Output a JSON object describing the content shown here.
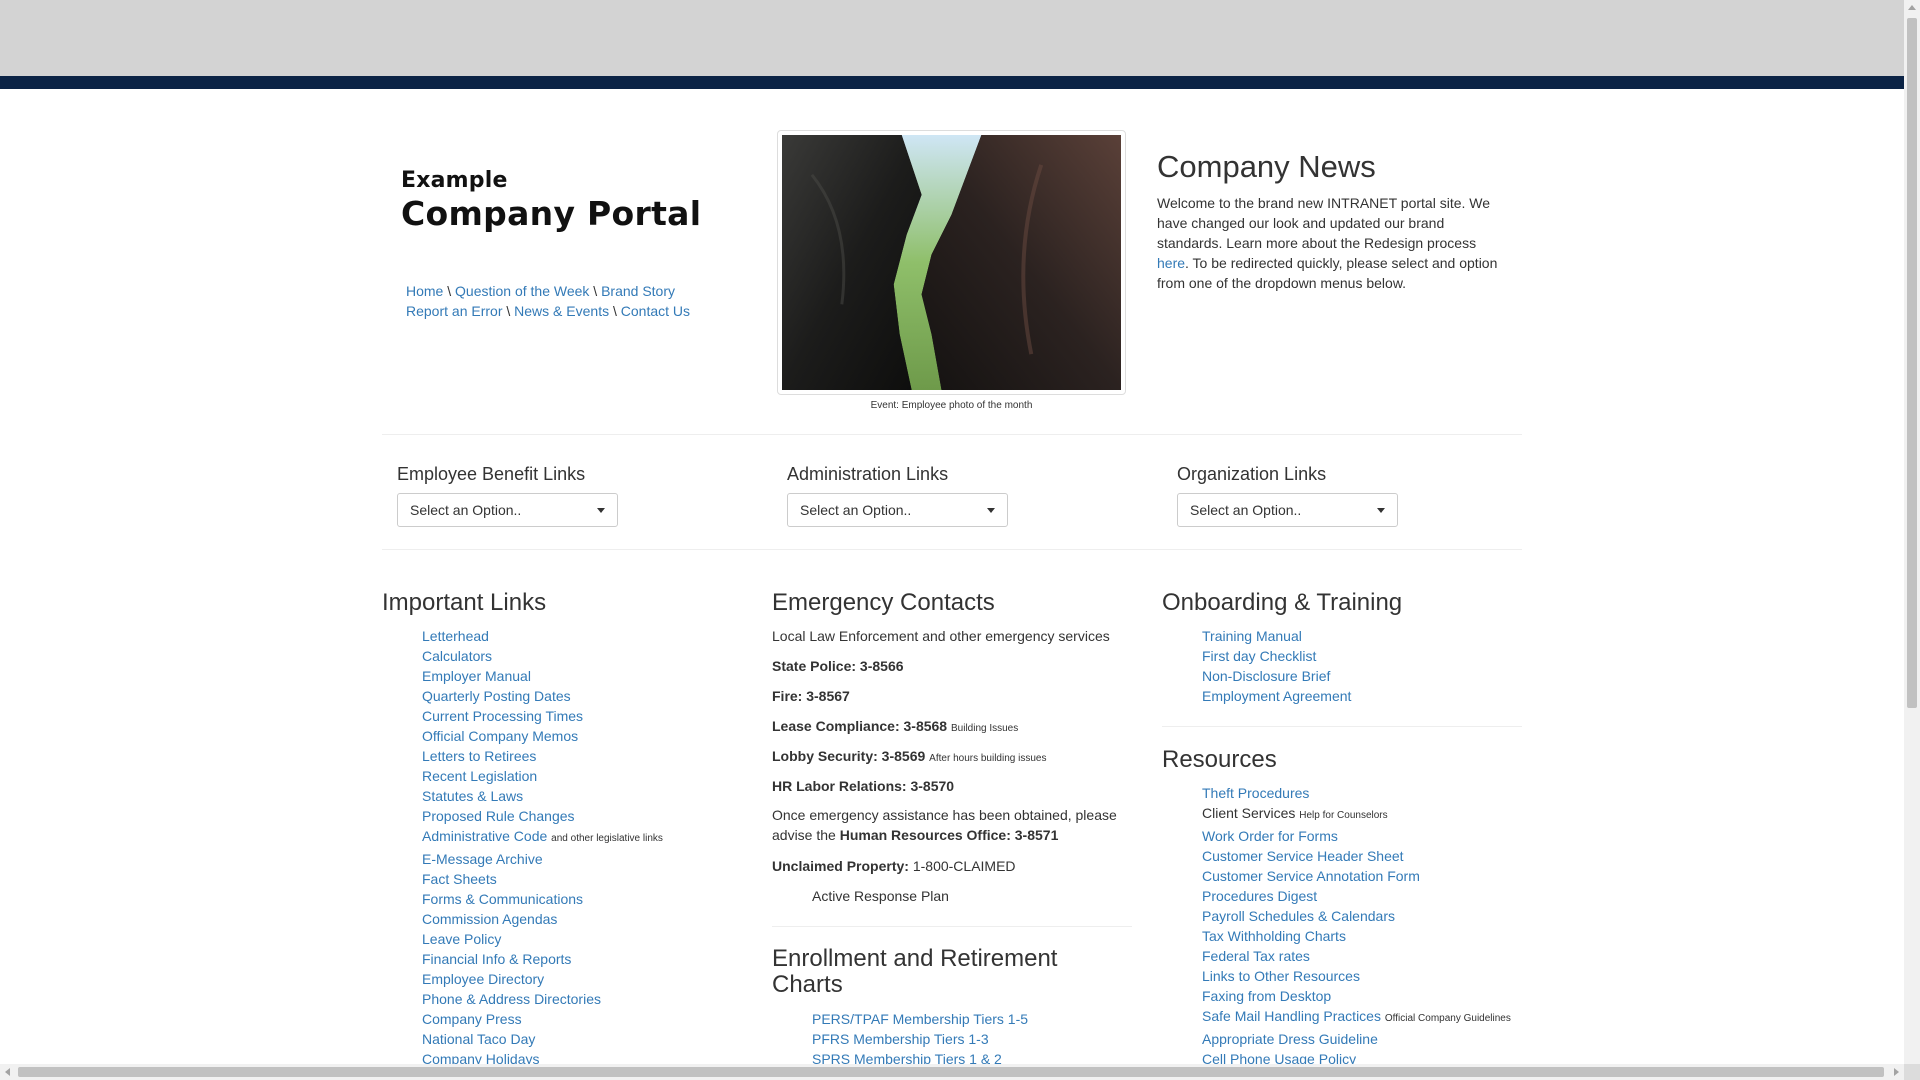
{
  "logo": {
    "line1": "Example",
    "line2": "Company Portal"
  },
  "breadcrumbs": {
    "row1": [
      "Home",
      "Question of the Week",
      "Brand Story"
    ],
    "row2": [
      "Report an Error",
      "News & Events",
      "Contact Us"
    ],
    "separator": "\\"
  },
  "photo": {
    "caption": "Event: Employee photo of the month"
  },
  "news": {
    "title": "Company News",
    "text_before": "Welcome to the brand new INTRANET portal site. We have changed our look and updated our brand standards. Learn more about the Redesign process ",
    "link": "here",
    "text_after": ". To be redirected quickly, please select and option from one of the dropdown menus below."
  },
  "dropdowns": [
    {
      "label": "Employee Benefit Links",
      "value": "Select an Option.."
    },
    {
      "label": "Administration Links",
      "value": "Select an Option.."
    },
    {
      "label": "Organization Links",
      "value": "Select an Option.."
    }
  ],
  "important_links": {
    "title": "Important Links",
    "items": [
      {
        "label": "Letterhead"
      },
      {
        "label": "Calculators"
      },
      {
        "label": "Employer Manual"
      },
      {
        "label": "Quarterly Posting Dates"
      },
      {
        "label": "Current Processing Times"
      },
      {
        "label": "Official Company Memos"
      },
      {
        "label": "Letters to Retirees"
      },
      {
        "label": "Recent Legislation"
      },
      {
        "label": "Statutes & Laws"
      },
      {
        "label": "Proposed Rule Changes"
      },
      {
        "label": "Administrative Code",
        "note": "and other legislative links"
      },
      {
        "label": "E-Message Archive"
      },
      {
        "label": "Fact Sheets"
      },
      {
        "label": "Forms & Communications"
      },
      {
        "label": "Commission Agendas"
      },
      {
        "label": "Leave Policy"
      },
      {
        "label": "Financial Info & Reports"
      },
      {
        "label": "Employee Directory"
      },
      {
        "label": "Phone & Address Directories"
      },
      {
        "label": "Company Press"
      },
      {
        "label": "National Taco Day"
      },
      {
        "label": "Company Holidays"
      }
    ]
  },
  "emergency": {
    "title": "Emergency Contacts",
    "intro": "Local Law Enforcement and other emergency services",
    "contacts": [
      {
        "label": "State Police: 3-8566",
        "note": ""
      },
      {
        "label": "Fire: 3-8567",
        "note": ""
      },
      {
        "label": "Lease Compliance: 3-8568",
        "note": "Building Issues"
      },
      {
        "label": "Lobby Security: 3-8569",
        "note": "After hours building issues"
      },
      {
        "label": "HR Labor Relations: 3-8570",
        "note": ""
      }
    ],
    "advise_text": "Once emergency assistance has been obtained, please advise the ",
    "advise_bold": "Human Resources Office: 3-8571",
    "unclaimed_label": "Unclaimed Property:",
    "unclaimed_value": "1-800-CLAIMED",
    "plan_link": "Active Response Plan"
  },
  "enrollment": {
    "title": "Enrollment and Retirement Charts",
    "items": [
      "PERS/TPAF Membership Tiers 1-5",
      "PFRS Membership Tiers 1-3",
      "SPRS Membership Tiers 1 & 2"
    ]
  },
  "onboarding": {
    "title": "Onboarding & Training",
    "items": [
      "Training Manual",
      "First day Checklist",
      "Non-Disclosure Brief",
      "Employment Agreement"
    ]
  },
  "resources": {
    "title": "Resources",
    "items": [
      {
        "label": "Theft Procedures",
        "link": true
      },
      {
        "label": "Client Services",
        "note": "Help for Counselors",
        "link": false
      },
      {
        "label": "Work Order for Forms",
        "link": true
      },
      {
        "label": "Customer Service Header Sheet",
        "link": true
      },
      {
        "label": "Customer Service Annotation Form",
        "link": true
      },
      {
        "label": "Procedures Digest",
        "link": true
      },
      {
        "label": "Payroll Schedules & Calendars",
        "link": true
      },
      {
        "label": "Tax Withholding Charts",
        "link": true
      },
      {
        "label": "Federal Tax rates",
        "link": true
      },
      {
        "label": "Links to Other Resources",
        "link": true
      },
      {
        "label": "Faxing from Desktop",
        "link": true
      },
      {
        "label": "Safe Mail Handling Practices",
        "note": "Official Company Guidelines",
        "link": true
      },
      {
        "label": "Appropriate Dress Guideline",
        "link": true
      },
      {
        "label": "Cell Phone Usage Policy",
        "link": true
      }
    ]
  },
  "colors": {
    "navy_band": "#0b2345",
    "gray_header": "#d3d3d3",
    "link": "#337ab7"
  }
}
